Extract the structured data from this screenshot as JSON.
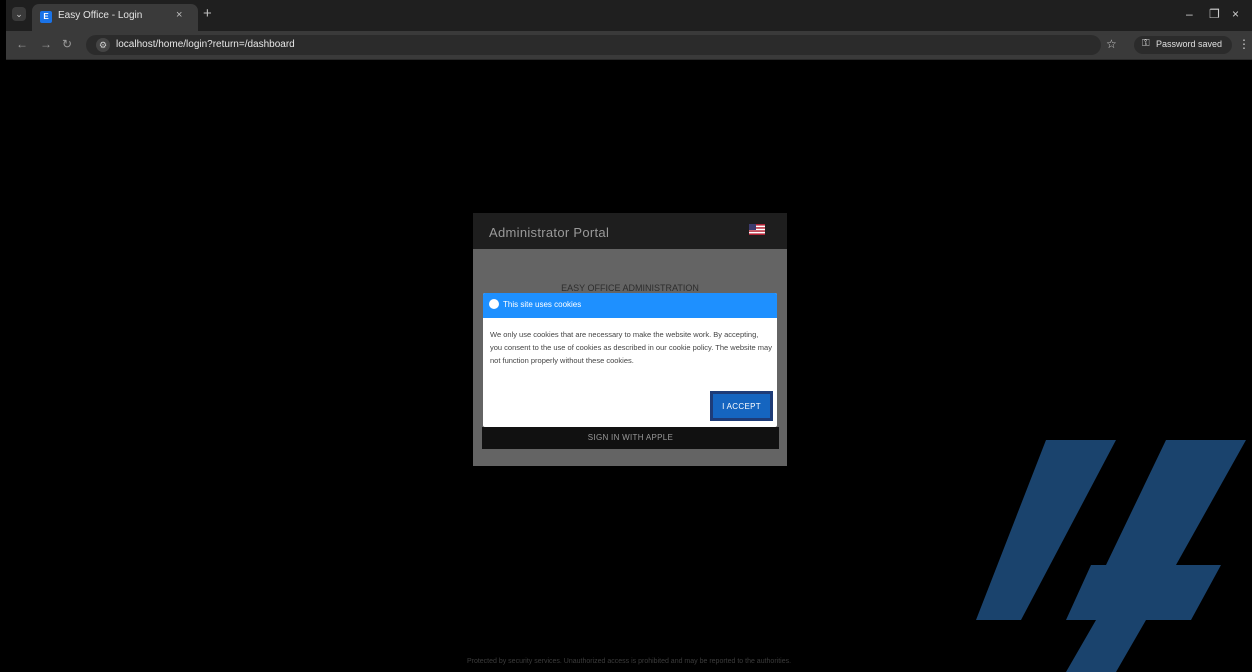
{
  "browser": {
    "tab_title": "Easy Office - Login",
    "tab_close": "×",
    "new_tab": "+",
    "url": "localhost/home/login?return=/dashboard",
    "profile_label": "Password saved",
    "window_controls": {
      "minimize": "–",
      "restore": "❐",
      "close": "×"
    },
    "icons": [
      "tab-search-icon",
      "favicon-icon",
      "back-icon",
      "forward-icon",
      "reload-icon",
      "site-info-icon",
      "star-icon",
      "key-icon",
      "menu-icon"
    ]
  },
  "portal": {
    "title": "Administrator Portal",
    "subtitle": "EASY OFFICE ADMINISTRATION",
    "signin_label": "SIGN IN WITH APPLE",
    "flag": "us-flag-icon"
  },
  "cookie_modal": {
    "title": "This site uses cookies",
    "body": "We only use cookies that are necessary to make the website work. By accepting, you consent to the use of cookies as described in our cookie policy. The website may not function properly without these cookies.",
    "accept_label": "I ACCEPT",
    "header_color": "#1e90ff",
    "button_color": "#1565c0"
  },
  "footer": {
    "text": "Protected by security services. Unauthorized access is prohibited and may be reported to the authorities."
  },
  "colors": {
    "page_background": "#000000",
    "logo_blue": "#1f4f80",
    "panel_gray": "#646464"
  }
}
